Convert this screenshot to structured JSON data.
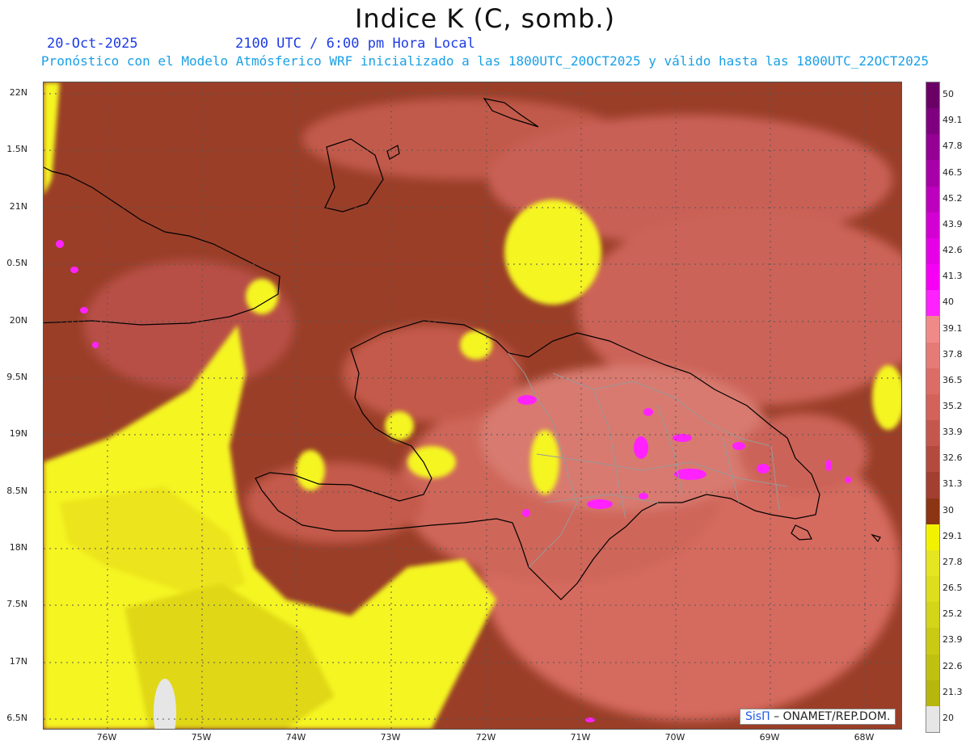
{
  "title": "Indice K (C, somb.)",
  "date": "20-Oct-2025",
  "time": "2100 UTC / 6:00 pm Hora Local",
  "subtitle": "Pronóstico con el Modelo Atmósferico WRF inicializado a las 1800UTC_20OCT2025 y válido hasta las  1800UTC_22OCT2025",
  "credit": {
    "brand": "SisΠ",
    "org": "– ONAMET/REP.DOM."
  },
  "lat_labels": [
    "22N",
    "1.5N",
    "21N",
    "0.5N",
    "20N",
    "9.5N",
    "19N",
    "8.5N",
    "18N",
    "7.5N",
    "17N",
    "6.5N"
  ],
  "lon_labels": [
    "76W",
    "75W",
    "74W",
    "73W",
    "72W",
    "71W",
    "70W",
    "69W",
    "68W"
  ],
  "legend": {
    "labels": [
      "50",
      "49.1",
      "47.8",
      "46.5",
      "45.2",
      "43.9",
      "42.6",
      "41.3",
      "40",
      "39.1",
      "37.8",
      "36.5",
      "35.2",
      "33.9",
      "32.6",
      "31.3",
      "30",
      "29.1",
      "27.8",
      "26.5",
      "25.2",
      "23.9",
      "22.6",
      "21.3",
      "20"
    ],
    "colors": [
      "#6a0066",
      "#7e007e",
      "#930093",
      "#a800a8",
      "#bd00bd",
      "#d200d2",
      "#e600e6",
      "#f500f5",
      "#ff22ff",
      "#f08a88",
      "#e67a76",
      "#dc6c66",
      "#d2625a",
      "#c4574d",
      "#b44a3e",
      "#a23f30",
      "#8b3515",
      "#f2f200",
      "#e5e522",
      "#dede1c",
      "#d4d418",
      "#caca14",
      "#c0c010",
      "#b6b60c",
      "#e6e6e6"
    ]
  },
  "map_colors": {
    "background": "#9a3e28",
    "warm_high": "#d86a5e",
    "warm_mid": "#c45a4c",
    "cool_low": "#f5f520",
    "cool_lower": "#c8c818",
    "extreme": "#ff22ff",
    "coast": "#000000",
    "borders": "#999999"
  }
}
